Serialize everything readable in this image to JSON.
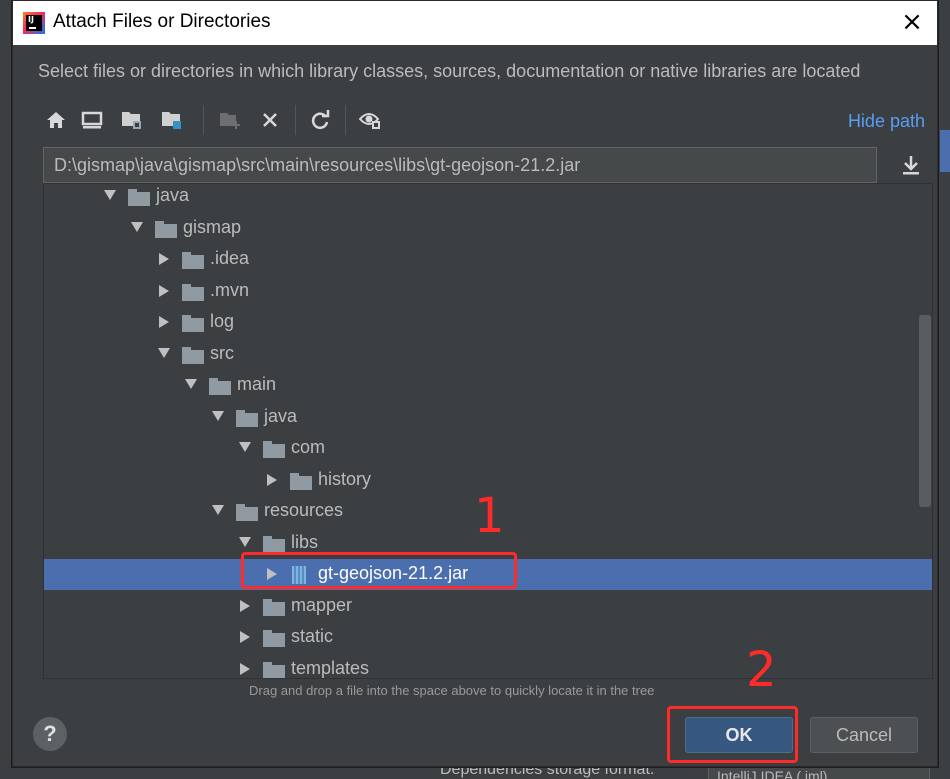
{
  "dialog": {
    "title": "Attach Files or Directories",
    "description": "Select files or directories in which library classes, sources, documentation or native libraries are located",
    "hide_path": "Hide path",
    "path_value": "D:\\gismap\\java\\gismap\\src\\main\\resources\\libs\\gt-geojson-21.2.jar",
    "hint": "Drag and drop a file into the space above to quickly locate it in the tree",
    "ok_label": "OK",
    "cancel_label": "Cancel",
    "help_label": "?"
  },
  "toolbar": {
    "icons": [
      "home-icon",
      "desktop-icon",
      "project-folder-icon",
      "module-folder-icon",
      "new-folder-icon",
      "delete-icon",
      "refresh-icon",
      "show-hidden-icon"
    ]
  },
  "tree": {
    "rows": [
      {
        "label": "java",
        "depth": 0,
        "state": "expanded",
        "kind": "folder"
      },
      {
        "label": "gismap",
        "depth": 1,
        "state": "expanded",
        "kind": "folder"
      },
      {
        "label": ".idea",
        "depth": 2,
        "state": "collapsed",
        "kind": "folder"
      },
      {
        "label": ".mvn",
        "depth": 2,
        "state": "collapsed",
        "kind": "folder"
      },
      {
        "label": "log",
        "depth": 2,
        "state": "collapsed",
        "kind": "folder"
      },
      {
        "label": "src",
        "depth": 2,
        "state": "expanded",
        "kind": "folder"
      },
      {
        "label": "main",
        "depth": 3,
        "state": "expanded",
        "kind": "folder"
      },
      {
        "label": "java",
        "depth": 4,
        "state": "expanded",
        "kind": "folder"
      },
      {
        "label": "com",
        "depth": 5,
        "state": "expanded",
        "kind": "folder"
      },
      {
        "label": "history",
        "depth": 6,
        "state": "collapsed",
        "kind": "folder"
      },
      {
        "label": "resources",
        "depth": 4,
        "state": "expanded",
        "kind": "folder"
      },
      {
        "label": "libs",
        "depth": 5,
        "state": "expanded",
        "kind": "folder"
      },
      {
        "label": "gt-geojson-21.2.jar",
        "depth": 6,
        "state": "collapsed",
        "kind": "jar",
        "selected": true
      },
      {
        "label": "mapper",
        "depth": 5,
        "state": "collapsed",
        "kind": "folder"
      },
      {
        "label": "static",
        "depth": 5,
        "state": "collapsed",
        "kind": "folder"
      },
      {
        "label": "templates",
        "depth": 5,
        "state": "collapsed",
        "kind": "folder"
      }
    ]
  },
  "annotations": {
    "step1": "1",
    "step2": "2"
  },
  "background": {
    "bottom_label": "Dependencies storage format:",
    "bottom_select": "IntelliJ IDEA (.iml)"
  },
  "colors": {
    "accent": "#4b6eaf",
    "link": "#589df6",
    "annotation": "#ff2a2a"
  }
}
